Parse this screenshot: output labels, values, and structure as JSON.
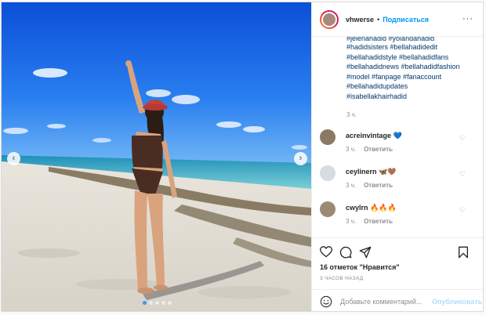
{
  "post": {
    "username": "vhwerse",
    "separator": "•",
    "follow_label": "Подписаться",
    "more_icon": "more-horizontal-icon",
    "caption_hashtags": [
      "#jelenahadid #yolandahadid",
      "#hadidsisters #bellahadidedit",
      "#bellahadidstyle #bellahadidfans",
      "#bellahadidnews #bellahadidfashion",
      "#model #fanpage #fanaccount",
      "#bellahadidupdates",
      "#isabellakhairhadid"
    ],
    "caption_time": "3 ч.",
    "comments": [
      {
        "user": "acreinvintage",
        "text": "💙",
        "time": "3 ч.",
        "reply": "Ответить"
      },
      {
        "user": "ceylinern",
        "text": "🦋🤎",
        "time": "3 ч.",
        "reply": "Ответить"
      },
      {
        "user": "cwylrn",
        "text": "🔥🔥🔥",
        "time": "3 ч.",
        "reply": "Ответить"
      }
    ],
    "likes": "16 отметок \"Нравится\"",
    "time_ago": "3 ЧАСОВ НАЗАД",
    "add_comment_placeholder": "Добавьте комментарий...",
    "publish_label": "Опубликовать",
    "carousel": {
      "total_slides": 5,
      "active_slide": 1
    }
  },
  "colors": {
    "accent": "#0095f6",
    "username": "#262626",
    "hashtag": "#00376b",
    "muted": "#8e8e8e",
    "publish_disabled": "#b2dffc"
  }
}
